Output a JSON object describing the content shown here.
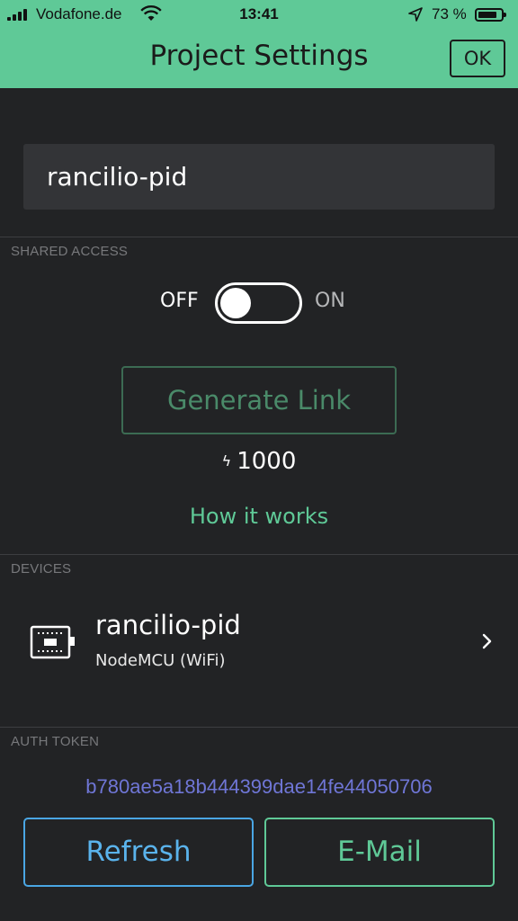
{
  "status_bar": {
    "carrier": "Vodafone.de",
    "time": "13:41",
    "battery_percent": "73 %",
    "battery_level": 0.73,
    "signal_icon": "cellular-signal-icon",
    "wifi_icon": "wifi-icon",
    "location_icon": "location-arrow-icon",
    "battery_icon": "battery-icon"
  },
  "header": {
    "title": "Project Settings",
    "ok_label": "OK",
    "background": "#5fc997"
  },
  "project": {
    "name": "rancilio-pid"
  },
  "shared_access": {
    "section_label": "SHARED ACCESS",
    "off_label": "OFF",
    "on_label": "ON",
    "toggle_state": "off",
    "generate_label": "Generate Link",
    "energy_icon": "lightning-bolt-icon",
    "energy_value": "1000",
    "how_label": "How it works"
  },
  "devices": {
    "section_label": "DEVICES",
    "items": [
      {
        "name": "rancilio-pid",
        "type": "NodeMCU (WiFi)",
        "icon": "board-chip-icon",
        "chevron": "chevron-right-icon"
      }
    ]
  },
  "auth": {
    "section_label": "AUTH TOKEN",
    "token": "b780ae5a18b444399dae14fe44050706",
    "refresh_label": "Refresh",
    "email_label": "E-Mail"
  },
  "colors": {
    "accent_green": "#5fc997",
    "background": "#222325",
    "token_blue": "#6f76d6",
    "refresh_blue": "#4aa6e4"
  }
}
